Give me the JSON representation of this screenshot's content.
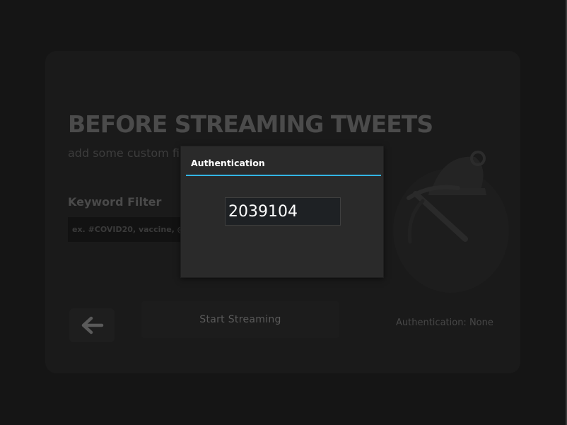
{
  "screen": {
    "title": "BEFORE STREAMING TWEETS",
    "subtitle": "add some custom filte",
    "keyword_filter": {
      "label": "Keyword Filter",
      "placeholder": "ex. #COVID20, vaccine, @e"
    },
    "back_icon": "arrow-left-icon",
    "start_button_label": "Start Streaming",
    "auth_status": "Authentication: None",
    "logo_icon": "miner-helmet-pickaxe-icon"
  },
  "dialog": {
    "title": "Authentication",
    "code_value": "2039104",
    "accent_color": "#33b5e5"
  },
  "colors": {
    "background": "#151515",
    "panel": "#1a1a1a",
    "dialog": "#2a2a2a",
    "accent": "#33b5e5"
  }
}
